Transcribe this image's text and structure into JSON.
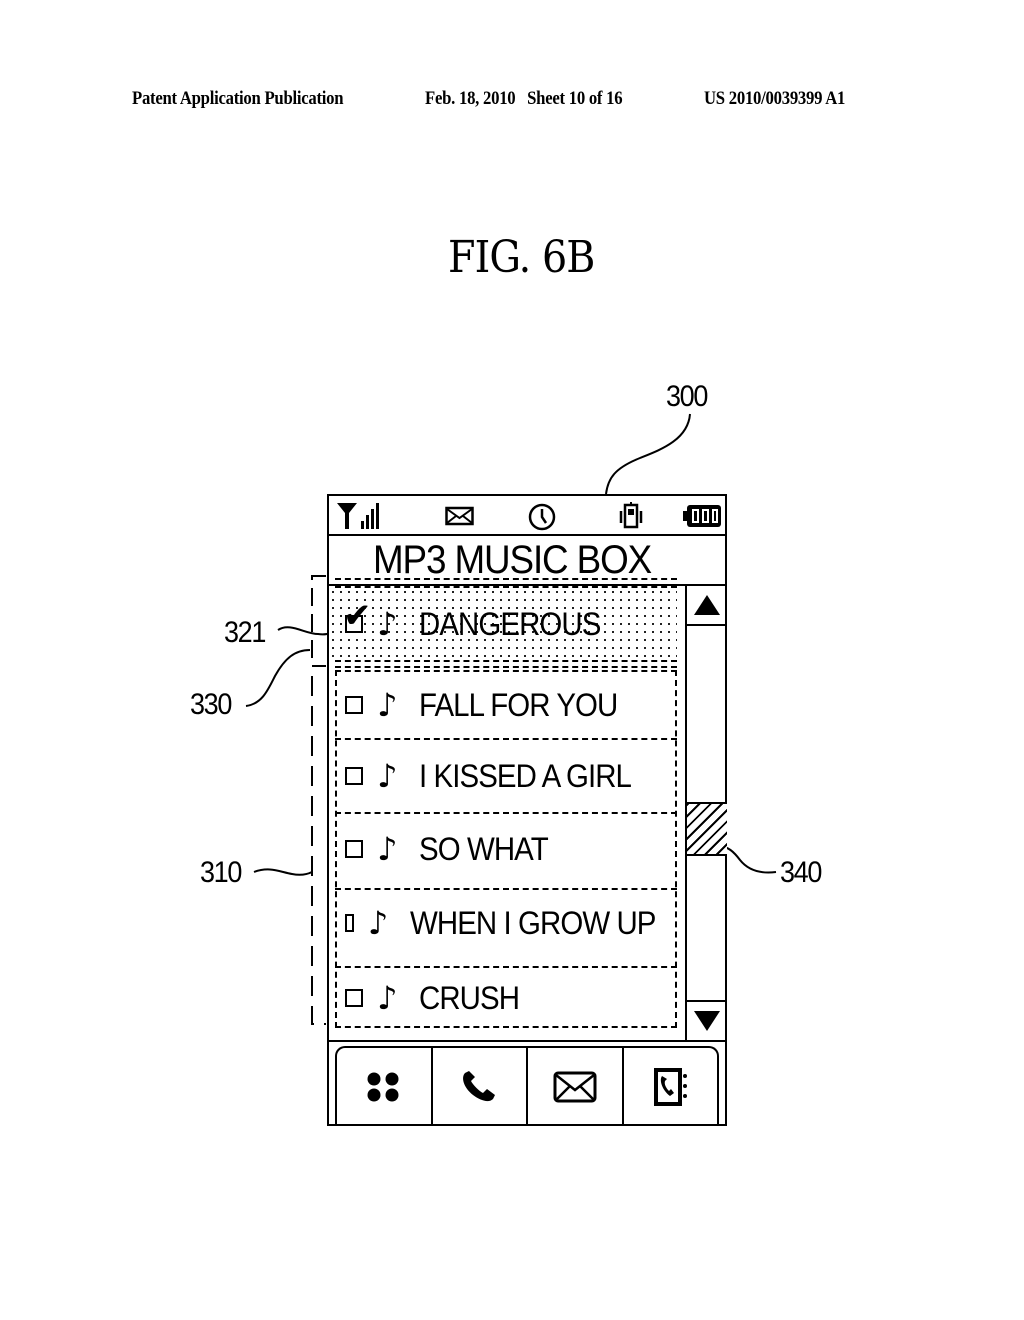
{
  "header": {
    "publication": "Patent Application Publication",
    "date_sheet": "Feb. 18, 2010   Sheet 10 of 16",
    "patent_number": "US 2010/0039399 A1"
  },
  "figure": {
    "title": "FIG. 6B",
    "reference_labels": {
      "device": "300",
      "list_area": "310",
      "checkbox": "321",
      "selected_item": "330",
      "scroll_indicator": "340"
    }
  },
  "phone": {
    "status_bar": {
      "icons": [
        "signal-strength-icon",
        "message-envelope-icon",
        "clock-alarm-icon",
        "vibrate-mode-icon",
        "battery-icon"
      ]
    },
    "app_title": "MP3 MUSIC BOX",
    "song_list": [
      {
        "title": "DANGEROUS",
        "checked": true,
        "selected": true,
        "icon": "music-note-icon"
      },
      {
        "title": "FALL FOR YOU",
        "checked": false,
        "selected": false,
        "icon": "music-note-icon"
      },
      {
        "title": "I KISSED A GIRL",
        "checked": false,
        "selected": false,
        "icon": "music-note-icon"
      },
      {
        "title": "SO WHAT",
        "checked": false,
        "selected": false,
        "icon": "music-note-icon"
      },
      {
        "title": "WHEN I GROW UP",
        "checked": false,
        "selected": false,
        "icon": "music-note-icon"
      },
      {
        "title": "CRUSH",
        "checked": false,
        "selected": false,
        "icon": "music-note-icon"
      }
    ],
    "note_glyph": "♪",
    "check_glyph": "✔",
    "scrollbar": {
      "up_icon": "scroll-up-triangle-icon",
      "down_icon": "scroll-down-triangle-icon",
      "position_fraction": 0.55
    },
    "soft_keys": [
      {
        "name": "menu",
        "icon": "menu-grid-icon"
      },
      {
        "name": "call",
        "icon": "phone-handset-icon"
      },
      {
        "name": "message",
        "icon": "envelope-icon"
      },
      {
        "name": "phonebook",
        "icon": "phonebook-icon"
      }
    ]
  }
}
